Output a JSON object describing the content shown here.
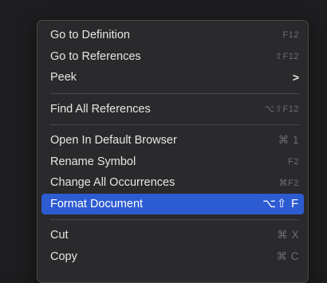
{
  "menu": {
    "groups": [
      [
        {
          "label": "Go to Definition",
          "shortcut": "F12"
        },
        {
          "label": "Go to References",
          "shortcut": "⇧F12"
        },
        {
          "label": "Peek",
          "shortcut": ">",
          "submenu": true
        }
      ],
      [
        {
          "label": "Find All References",
          "shortcut": "⌥⇧F12"
        }
      ],
      [
        {
          "label": "Open In Default Browser",
          "shortcut": "⌘ 1"
        },
        {
          "label": "Rename Symbol",
          "shortcut": "F2"
        },
        {
          "label": "Change All Occurrences",
          "shortcut": "⌘F2"
        },
        {
          "label": "Format Document",
          "shortcut": "⌥⇧ F",
          "selected": true
        }
      ],
      [
        {
          "label": "Cut",
          "shortcut": "⌘ X"
        },
        {
          "label": "Copy",
          "shortcut": "⌘ C"
        }
      ]
    ]
  },
  "colors": {
    "selection": "#2d5bd2",
    "menu_background": "#2a2a2c",
    "text": "#e6e6e6",
    "shortcut_text": "#6e6e72"
  }
}
